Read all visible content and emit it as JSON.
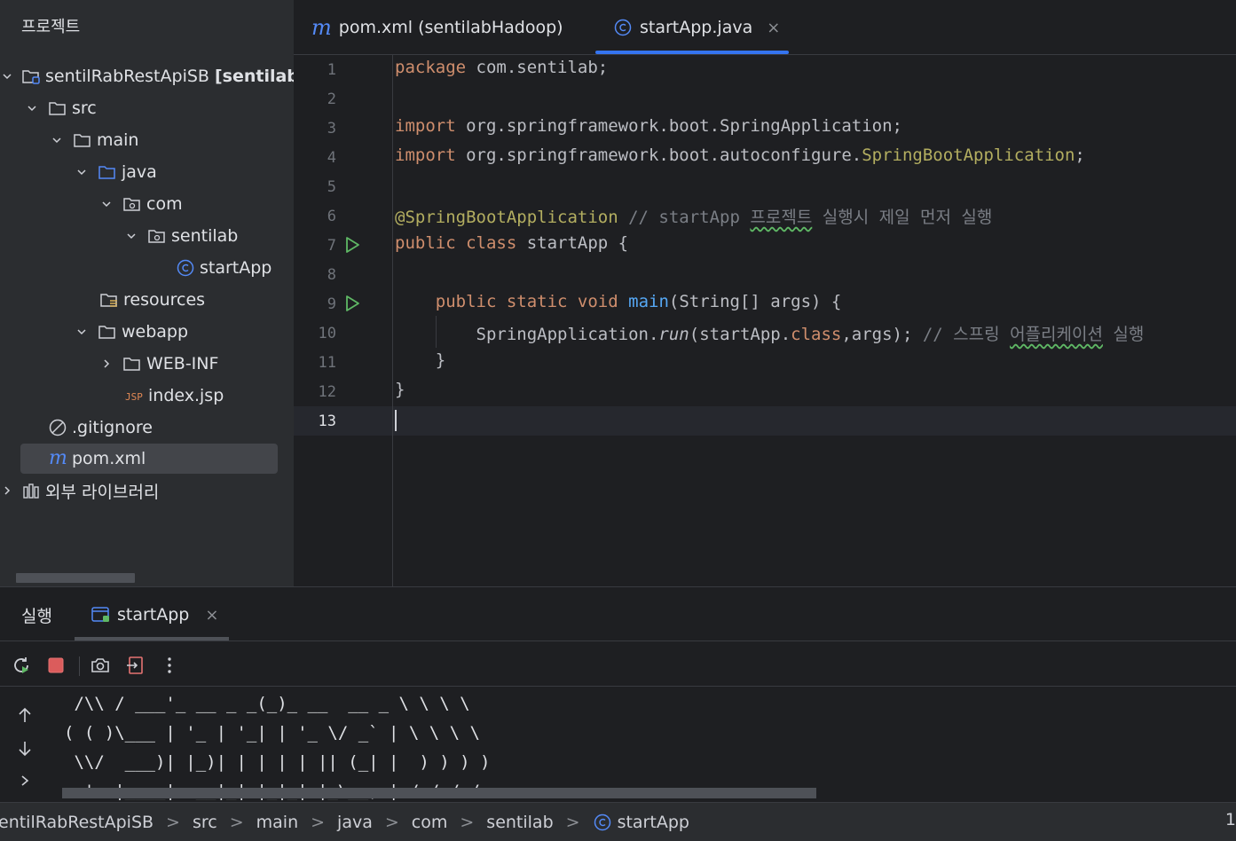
{
  "project": {
    "title": "프로젝트",
    "root_name": "sentilRabRestApiSB",
    "root_sub": "[sentilab",
    "items": [
      {
        "label": "src"
      },
      {
        "label": "main"
      },
      {
        "label": "java"
      },
      {
        "label": "com"
      },
      {
        "label": "sentilab"
      },
      {
        "label": "startApp"
      },
      {
        "label": "resources"
      },
      {
        "label": "webapp"
      },
      {
        "label": "WEB-INF"
      },
      {
        "label": "index.jsp"
      },
      {
        "label": ".gitignore"
      },
      {
        "label": "pom.xml"
      },
      {
        "label": "외부 라이브러리"
      }
    ]
  },
  "tabs": [
    {
      "label": "pom.xml (sentilabHadoop)",
      "icon": "maven-icon"
    },
    {
      "label": "startApp.java",
      "icon": "class-icon",
      "active": true,
      "close": "×"
    }
  ],
  "editor": {
    "line_numbers": [
      "1",
      "2",
      "3",
      "4",
      "5",
      "6",
      "7",
      "8",
      "9",
      "10",
      "11",
      "12",
      "13"
    ],
    "current_line": 13,
    "code": {
      "l1": {
        "kw": "package",
        "rest": " com.sentilab;"
      },
      "l3": {
        "kw": "import",
        "rest": " org.springframework.boot.SpringApplication;"
      },
      "l4": {
        "kw": "import",
        "rest": " org.springframework.boot.autoconfigure.",
        "ann": "SpringBootApplication",
        "end": ";"
      },
      "l6": {
        "ann": "@SpringBootApplication",
        "cmt1": " // startApp ",
        "cmt_wavy": "프로젝트",
        "cmt2": " 실행시 제일 먼저 실행"
      },
      "l7": {
        "kw": "public class",
        "rest": " startApp {"
      },
      "l9": {
        "indent": "    ",
        "kw": "public static void",
        "sp": " ",
        "fn": "main",
        "rest": "(String[] args) {"
      },
      "l10": {
        "indent": "        ",
        "a": "SpringApplication.",
        "it": "run",
        "b": "(startApp.",
        "kw": "class",
        "c": ",args); ",
        "cmt1": "// 스프링 ",
        "cmt_wavy": "어플리케이션",
        "cmt2": " 실행"
      },
      "l11": {
        "text": "    }"
      },
      "l12": {
        "text": "}"
      }
    }
  },
  "run": {
    "title": "실행",
    "tab_label": "startApp",
    "tab_close": "×",
    "console_lines": [
      " /\\\\ / ___'_ __ _ _(_)_ __  __ _ \\ \\ \\ \\",
      "( ( )\\___ | '_ | '_| | '_ \\/ _` | \\ \\ \\ \\",
      " \\\\/  ___)| |_)| | | | | || (_| |  ) ) ) )",
      "  '  |____| .__|_| |_|_| |_\\__, | / / / /"
    ]
  },
  "status": {
    "breadcrumb": [
      "entilRabRestApiSB",
      "src",
      "main",
      "java",
      "com",
      "sentilab",
      "startApp"
    ],
    "separator": ">",
    "right_text": "1"
  },
  "colors": {
    "accent": "#3574f0",
    "keyword": "#cf8e6d",
    "annotation": "#b3ae60",
    "comment": "#7a7e85",
    "function": "#56a8f5",
    "run_green": "#5fb865",
    "stop_red": "#db5c5c"
  }
}
